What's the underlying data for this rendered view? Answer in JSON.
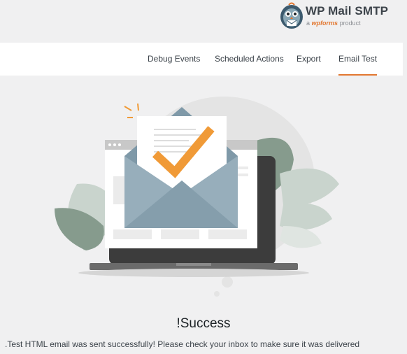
{
  "brand": {
    "title": "WP Mail SMTP",
    "tagline_prefix": "a",
    "tagline_brand": "wpforms",
    "tagline_suffix": "product",
    "accent_color": "#e27730"
  },
  "tabs": [
    {
      "label": "Debug Events",
      "active": false
    },
    {
      "label": "Scheduled Actions",
      "active": false
    },
    {
      "label": "Export",
      "active": false
    },
    {
      "label": "Email Test",
      "active": true
    }
  ],
  "illustration": {
    "description_icon": "email-sent-illustration-icon"
  },
  "result": {
    "title": "!Success",
    "message": ".Test HTML email was sent successfully! Please check your inbox to make sure it was delivered"
  }
}
